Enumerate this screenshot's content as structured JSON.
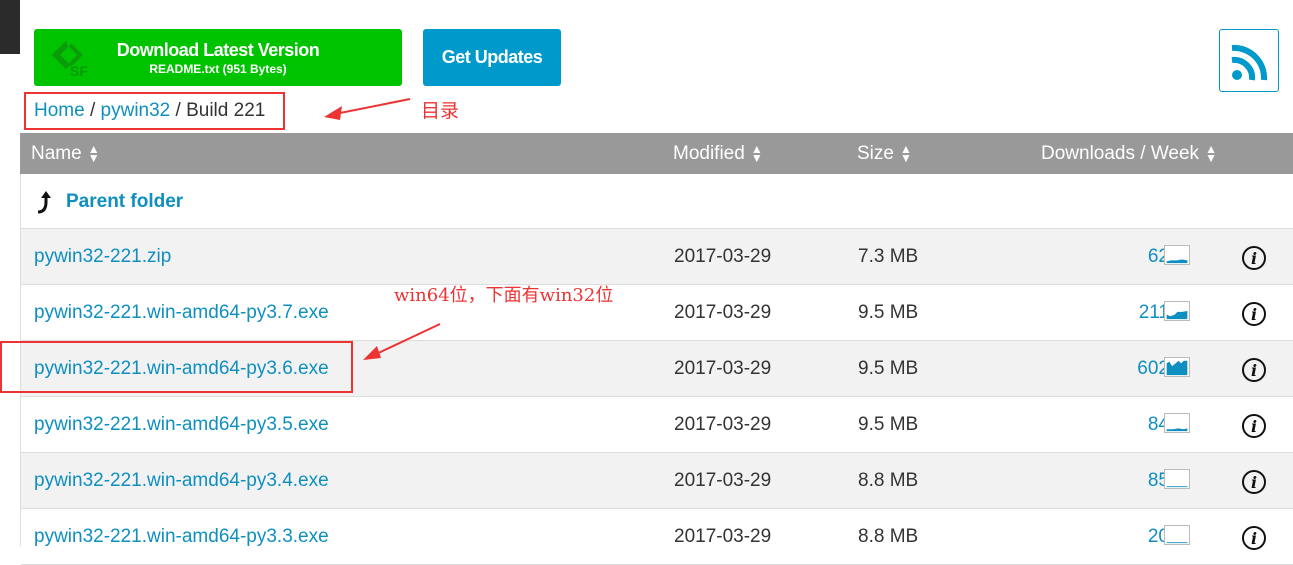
{
  "download": {
    "title": "Download Latest Version",
    "subtitle": "README.txt (951 Bytes)",
    "color": "#00c300"
  },
  "get_updates": "Get Updates",
  "breadcrumb": {
    "home": "Home",
    "sep1": " / ",
    "project": "pywin32",
    "sep2": " / ",
    "current": "Build 221"
  },
  "annotations": {
    "breadcrumb_note": "目录",
    "row_note": "win64位，下面有win32位"
  },
  "table": {
    "headers": {
      "name": "Name",
      "modified": "Modified",
      "size": "Size",
      "downloads": "Downloads / Week"
    },
    "parent": "Parent folder",
    "rows": [
      {
        "name": "pywin32-221.zip",
        "modified": "2017-03-29",
        "size": "7.3 MB",
        "downloads": "62"
      },
      {
        "name": "pywin32-221.win-amd64-py3.7.exe",
        "modified": "2017-03-29",
        "size": "9.5 MB",
        "downloads": "211"
      },
      {
        "name": "pywin32-221.win-amd64-py3.6.exe",
        "modified": "2017-03-29",
        "size": "9.5 MB",
        "downloads": "602"
      },
      {
        "name": "pywin32-221.win-amd64-py3.5.exe",
        "modified": "2017-03-29",
        "size": "9.5 MB",
        "downloads": "84"
      },
      {
        "name": "pywin32-221.win-amd64-py3.4.exe",
        "modified": "2017-03-29",
        "size": "8.8 MB",
        "downloads": "85"
      },
      {
        "name": "pywin32-221.win-amd64-py3.3.exe",
        "modified": "2017-03-29",
        "size": "8.8 MB",
        "downloads": "20"
      }
    ]
  },
  "colors": {
    "link": "#0e8fc0",
    "accent": "#0099cc",
    "annotation": "#ee3333"
  }
}
